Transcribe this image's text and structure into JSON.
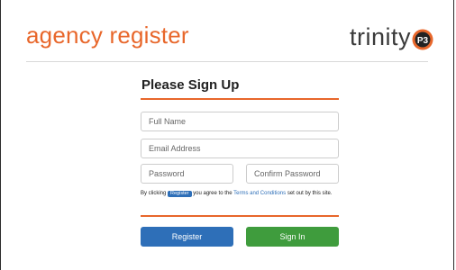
{
  "header": {
    "brand": "agency register",
    "logo_text": "trinity",
    "logo_badge": "P3"
  },
  "form": {
    "title": "Please Sign Up",
    "fields": {
      "full_name": "Full Name",
      "email": "Email Address",
      "password": "Password",
      "confirm_password": "Confirm Password"
    },
    "terms": {
      "prefix": "By clicking",
      "pill": "Register",
      "middle": "you agree to the",
      "link": "Terms and Conditions",
      "suffix": "set out by this site."
    },
    "buttons": {
      "register": "Register",
      "signin": "Sign In"
    }
  },
  "colors": {
    "accent_orange": "#e8672b",
    "register_blue": "#2e6fb8",
    "signin_green": "#3f9c3d"
  }
}
